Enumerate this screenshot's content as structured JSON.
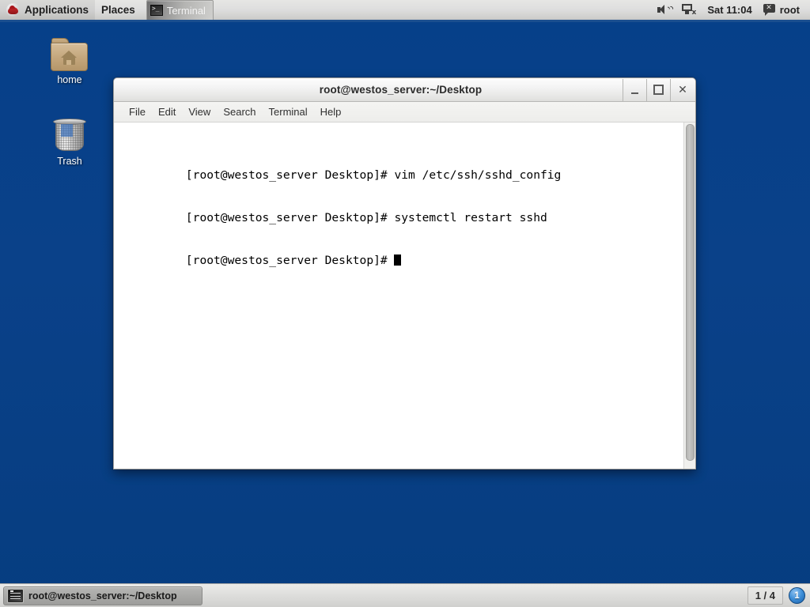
{
  "desktop": {
    "background_color": "#064089",
    "icons": [
      {
        "id": "home",
        "label": "home",
        "icon": "folder-home-icon"
      },
      {
        "id": "trash",
        "label": "Trash",
        "icon": "trash-can-icon"
      }
    ]
  },
  "top_panel": {
    "applications_label": "Applications",
    "places_label": "Places",
    "logo_icon": "redhat-logo-icon",
    "window_buttons": [
      {
        "label": "Terminal",
        "icon": "terminal-icon",
        "active": true
      }
    ],
    "tray": {
      "volume_icon": "speaker-volume-icon",
      "network_icon": "network-disconnected-icon",
      "clock": "Sat 11:04",
      "user_icon": "user-status-icon",
      "user_name": "root"
    }
  },
  "terminal_window": {
    "title": "root@westos_server:~/Desktop",
    "controls": {
      "minimize_label": "_",
      "maximize_label": "□",
      "close_label": "✕"
    },
    "menubar": [
      "File",
      "Edit",
      "View",
      "Search",
      "Terminal",
      "Help"
    ],
    "prompt": "[root@westos_server Desktop]# ",
    "lines": [
      {
        "prompt": "[root@westos_server Desktop]# ",
        "command": "vim /etc/ssh/sshd_config"
      },
      {
        "prompt": "[root@westos_server Desktop]# ",
        "command": "systemctl restart sshd"
      },
      {
        "prompt": "[root@westos_server Desktop]# ",
        "command": ""
      }
    ],
    "text_color": "#000000",
    "background_color": "#ffffff"
  },
  "bottom_panel": {
    "tasks": [
      {
        "label": "root@westos_server:~/Desktop",
        "icon": "terminal-icon",
        "active": true
      }
    ],
    "workspace_counter": "1 / 4",
    "workspace_current": "1"
  }
}
